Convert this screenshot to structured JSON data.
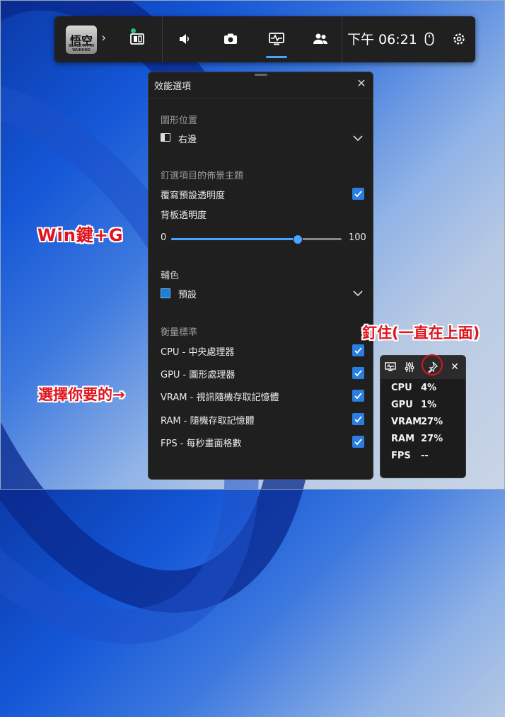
{
  "gamebar": {
    "app_label": "悟空",
    "app_sub": "BLACK MYTH WUKONG",
    "time": "下午 06:21",
    "icons": [
      "widget-menu-icon",
      "speaker-icon",
      "camera-icon",
      "performance-icon",
      "social-icon",
      "mouse-icon",
      "gear-icon"
    ]
  },
  "panel": {
    "title": "效能選項",
    "graph_position_label": "圖形位置",
    "graph_position_value": "右邊",
    "pinned_theme_label": "釘選項目的佈景主題",
    "override_transparency_label": "覆寫預設透明度",
    "backplate_transparency_label": "背板透明度",
    "slider_min": "0",
    "slider_max": "100",
    "slider_value": 74,
    "accent_label": "輔色",
    "accent_value": "預設",
    "accent_color": "#1e7fd6",
    "metrics_label": "衡量標準",
    "metrics": [
      {
        "label": "CPU - 中央處理器",
        "checked": true
      },
      {
        "label": "GPU - 圖形處理器",
        "checked": true
      },
      {
        "label": "VRAM - 視訊隨機存取記憶體",
        "checked": true
      },
      {
        "label": "RAM - 隨機存取記憶體",
        "checked": true
      },
      {
        "label": "FPS - 每秒畫面格數",
        "checked": true
      }
    ]
  },
  "mini": {
    "rows": [
      {
        "name": "CPU",
        "value": "4%"
      },
      {
        "name": "GPU",
        "value": "1%"
      },
      {
        "name": "VRAM",
        "value": "27%"
      },
      {
        "name": "RAM",
        "value": "27%"
      },
      {
        "name": "FPS",
        "value": "--"
      }
    ]
  },
  "annotations": {
    "win_g": "Win鍵+G",
    "pin_note": "釘住(一直在上面)",
    "choose_note": "選擇你要的→"
  }
}
